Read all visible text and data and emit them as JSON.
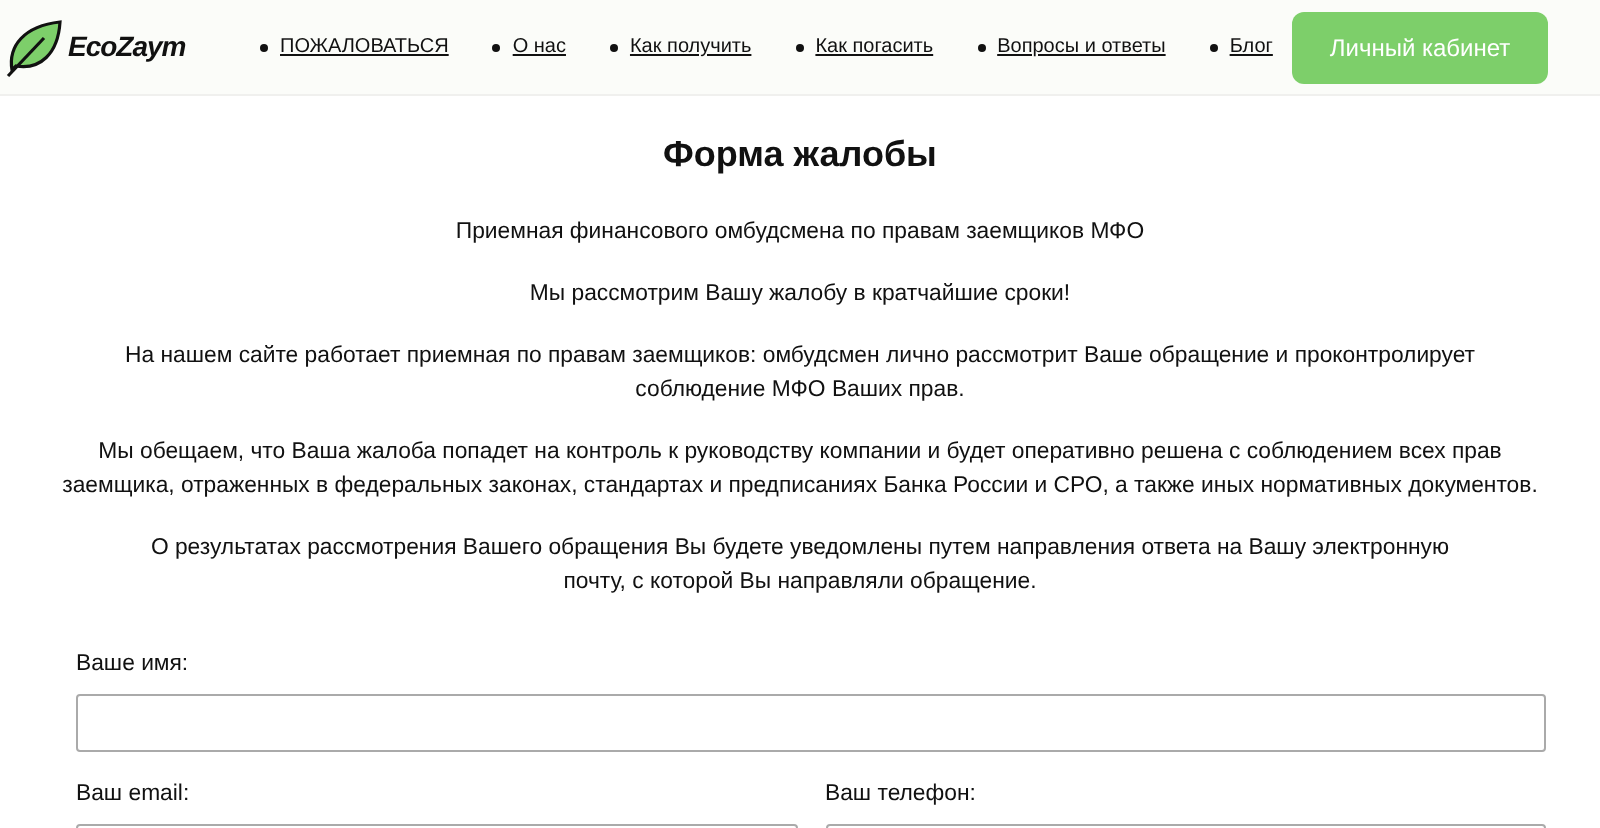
{
  "header": {
    "logo": "EcoZaym",
    "nav": [
      {
        "label": "ПОЖАЛОВАТЬСЯ"
      },
      {
        "label": "О нас"
      },
      {
        "label": "Как получить"
      },
      {
        "label": "Как погасить"
      },
      {
        "label": "Вопросы и ответы"
      },
      {
        "label": "Блог"
      }
    ],
    "account_button": "Личный кабинет"
  },
  "title": "Форма жалобы",
  "paragraphs": [
    "Приемная финансового омбудсмена по правам заемщиков МФО",
    "Мы рассмотрим Вашу жалобу в кратчайшие сроки!",
    "На нашем сайте работает приемная по правам заемщиков: омбудсмен лично рассмотрит Ваше обращение и проконтролирует соблюдение МФО Ваших прав.",
    "Мы обещаем, что Ваша жалоба попадет на контроль к руководству компании и будет оперативно решена с соблюдением всех прав заемщика, отраженных в федеральных законах, стандартах и предписаниях Банка России и СРО, а также иных нормативных документов.",
    "О результатах рассмотрения Вашего обращения Вы будете уведомлены путем направления ответа на Вашу электронную почту, с которой Вы направляли обращение."
  ],
  "form": {
    "name_label": "Ваше имя:",
    "email_label": "Ваш email:",
    "phone_label": "Ваш телефон:"
  }
}
